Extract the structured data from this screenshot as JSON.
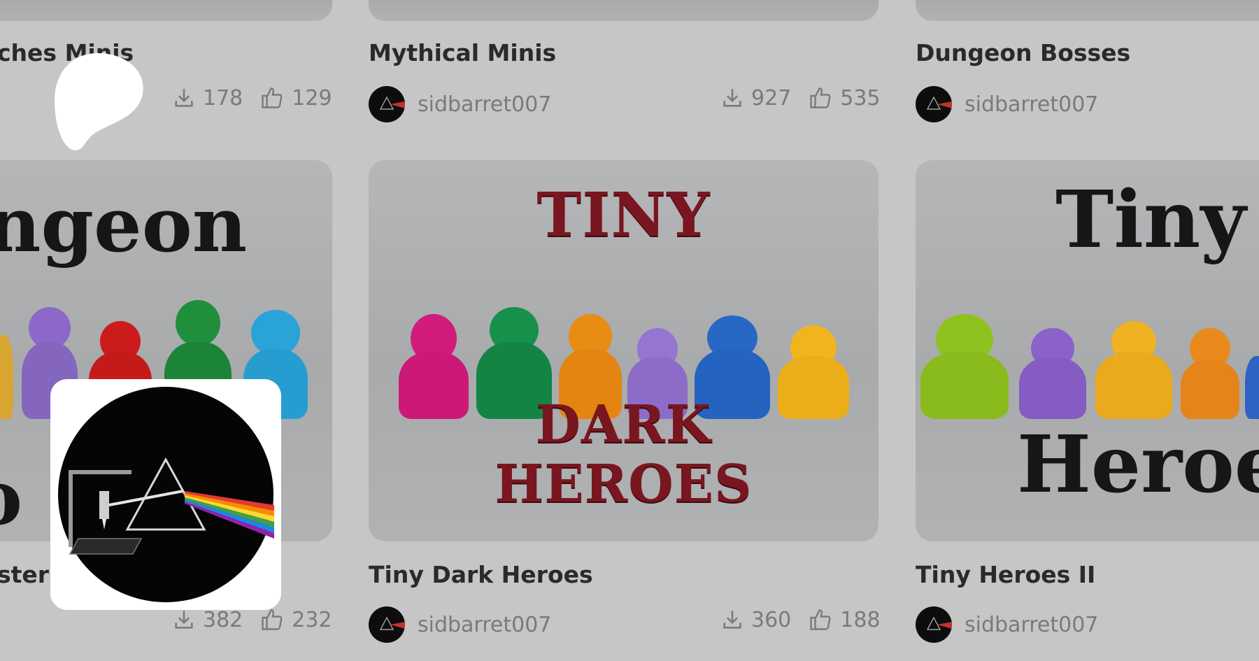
{
  "cards": [
    {
      "id": "c1",
      "title": "ches Minis",
      "author": "",
      "downloads": "178",
      "likes": "129"
    },
    {
      "id": "c2",
      "title": "Mythical Minis",
      "author": "sidbarret007",
      "downloads": "927",
      "likes": "535"
    },
    {
      "id": "c3",
      "title": "Dungeon Bosses",
      "author": "sidbarret007",
      "downloads": "",
      "likes": ""
    },
    {
      "id": "c4",
      "title": "sters",
      "author": "",
      "downloads": "382",
      "likes": "232",
      "image_text": [
        "ngeon",
        "o"
      ]
    },
    {
      "id": "c5",
      "title": "Tiny Dark Heroes",
      "author": "sidbarret007",
      "downloads": "360",
      "likes": "188",
      "image_text": [
        "TINY",
        "DARK",
        "HEROES"
      ]
    },
    {
      "id": "c6",
      "title": "Tiny Heroes II",
      "author": "sidbarret007",
      "downloads": "",
      "likes": "",
      "image_text": [
        "Tiny",
        "Heroes"
      ]
    }
  ],
  "icons": {
    "brand_logo": "patreon-logo",
    "download": "download-icon",
    "like": "thumbs-up-icon"
  },
  "colors": {
    "background": "#c6c6c6",
    "text_primary": "#2a2a2a",
    "text_secondary": "#7a7a7a",
    "prism_rainbow": [
      "#e53935",
      "#fb8c00",
      "#fdd835",
      "#43a047",
      "#1e88e5",
      "#8e24aa"
    ]
  }
}
